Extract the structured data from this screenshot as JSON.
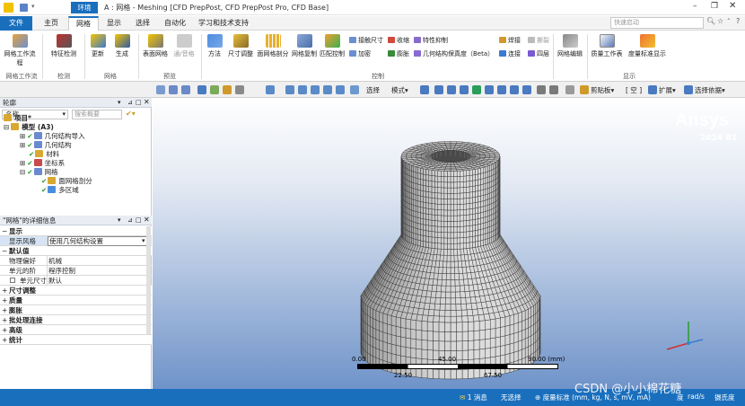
{
  "title_bar": {
    "contextual_tab": "环境",
    "window_title": "A : 网格 - Meshing [CFD PrepPost, CFD PrepPost Pro, CFD Base]"
  },
  "search": {
    "placeholder": "快速启动"
  },
  "tabs": [
    "文件",
    "主页",
    "网格",
    "显示",
    "选择",
    "自动化",
    "学习和技术支持"
  ],
  "ribbon": {
    "large_buttons": [
      "网格工作流程",
      "特征检测",
      "更新",
      "生成",
      "表面网格",
      "通/音格",
      "方法",
      "尺寸调整",
      "面网格剖分",
      "网格复制",
      "匹配控制",
      "网格编辑",
      "质量工作表",
      "度量标准显示"
    ],
    "small_items": [
      "接触尺寸",
      "加密",
      "收缩",
      "膨胀",
      "特性抑制",
      "几何结构保真度（Beta）",
      "焊接",
      "连接",
      "撕裂",
      "四层"
    ],
    "groups": [
      "网格工作流程",
      "检测",
      "网格",
      "预览",
      "控制",
      "显示"
    ]
  },
  "toolbar": {
    "select_label": "选择",
    "mode_label": "模式▾",
    "clipboard_label": "剪贴板▾",
    "empty_label": "[ 空 ]",
    "expand_label": "扩展▾",
    "select_by_label": "选择依据▾"
  },
  "outline": {
    "title": "轮廓",
    "name_label": "名称",
    "search_placeholder": "搜索概要",
    "tree": [
      {
        "label": "项目*",
        "level": 0
      },
      {
        "label": "模型 (A3)",
        "level": 1
      },
      {
        "label": "几何结构导入",
        "level": 2
      },
      {
        "label": "几何结构",
        "level": 2
      },
      {
        "label": "材料",
        "level": 2
      },
      {
        "label": "坐标系",
        "level": 2
      },
      {
        "label": "网格",
        "level": 2
      },
      {
        "label": "面网格剖分",
        "level": 3
      },
      {
        "label": "多区域",
        "level": 3
      }
    ]
  },
  "details": {
    "title": "\"网格\"的详细信息",
    "rows": [
      {
        "key": "显示",
        "value": "",
        "section": true
      },
      {
        "key": "显示风格",
        "value": "使用几何结构设置",
        "section": false,
        "highlight": true
      },
      {
        "key": "默认值",
        "value": "",
        "section": true
      },
      {
        "key": "物理偏好",
        "value": "机械",
        "section": false
      },
      {
        "key": "单元的阶",
        "value": "程序控制",
        "section": false
      },
      {
        "key": "单元尺寸",
        "value": "默认",
        "section": false
      },
      {
        "key": "尺寸调整",
        "value": "",
        "section": true
      },
      {
        "key": "质量",
        "value": "",
        "section": true
      },
      {
        "key": "膨胀",
        "value": "",
        "section": true
      },
      {
        "key": "批处理连接",
        "value": "",
        "section": true
      },
      {
        "key": "高级",
        "value": "",
        "section": true
      },
      {
        "key": "统计",
        "value": "",
        "section": true
      }
    ]
  },
  "viewport": {
    "brand": "Ansys",
    "version": "2024 R1",
    "scale_top": [
      "0.00",
      "45.00",
      "90.00 (mm)"
    ],
    "scale_bottom": [
      "22.50",
      "67.50"
    ]
  },
  "status": {
    "messages": "1 消息",
    "selection": "无选择",
    "metric": "度量标准 (mm, kg, N, s, mV, mA)",
    "degrees": "度",
    "rads": "rad/s",
    "temp": "摄氏度",
    "watermark": "CSDN @小小棉花糖"
  },
  "colors": {
    "accent": "#1a6fbd",
    "mesh_face": "#c8c8c8",
    "mesh_line": "#3a3a3a"
  }
}
